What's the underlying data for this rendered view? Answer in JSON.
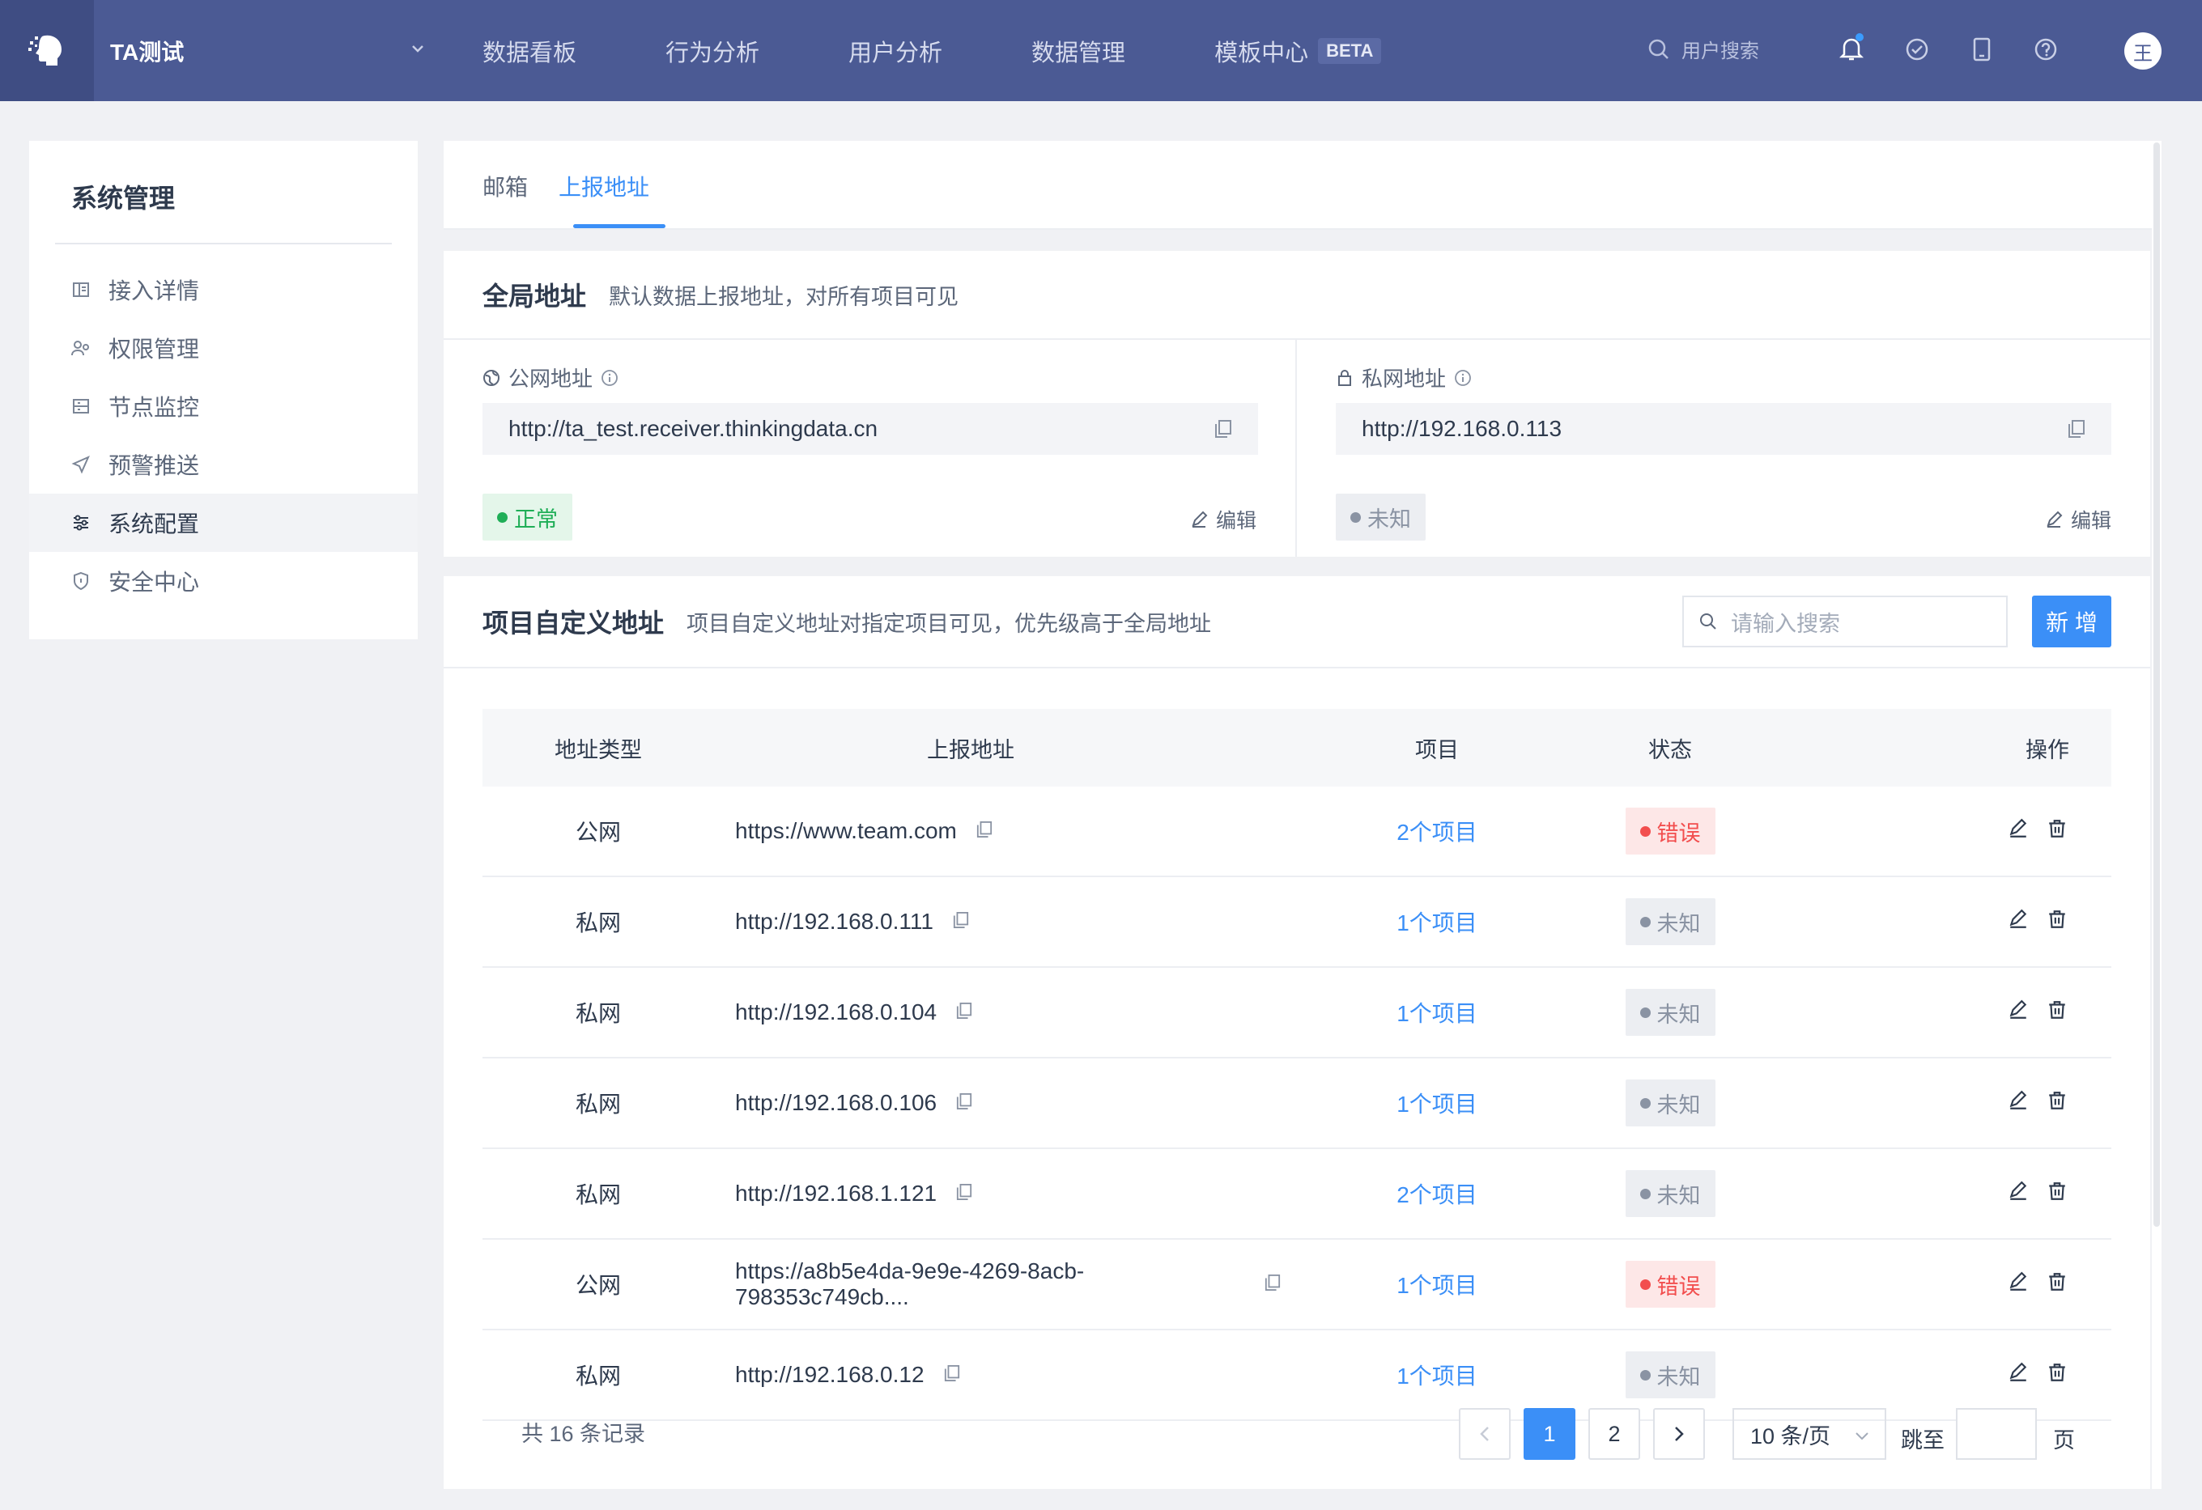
{
  "topbar": {
    "project_name": "TA测试",
    "nav": [
      "数据看板",
      "行为分析",
      "用户分析",
      "数据管理",
      "模板中心"
    ],
    "beta_label": "BETA",
    "search_placeholder": "用户搜索",
    "avatar_text": "王",
    "accent": "#4b5a94"
  },
  "sidebar": {
    "title": "系统管理",
    "items": [
      {
        "label": "接入详情",
        "icon": "book-icon"
      },
      {
        "label": "权限管理",
        "icon": "users-icon"
      },
      {
        "label": "节点监控",
        "icon": "monitor-icon"
      },
      {
        "label": "预警推送",
        "icon": "send-icon"
      },
      {
        "label": "系统配置",
        "icon": "sliders-icon",
        "active": true
      },
      {
        "label": "安全中心",
        "icon": "shield-icon"
      }
    ]
  },
  "tabs": [
    "邮箱",
    "上报地址"
  ],
  "active_tab": "上报地址",
  "global": {
    "title": "全局地址",
    "subtitle": "默认数据上报地址，对所有项目可见",
    "public": {
      "label": "公网地址",
      "url": "http://ta_test.receiver.thinkingdata.cn",
      "status": "正常",
      "edit": "编辑"
    },
    "private": {
      "label": "私网地址",
      "url": "http://192.168.0.113",
      "status": "未知",
      "edit": "编辑"
    }
  },
  "custom": {
    "title": "项目自定义地址",
    "subtitle": "项目自定义地址对指定项目可见，优先级高于全局地址",
    "search_placeholder": "请输入搜索",
    "add_label": "新 增",
    "columns": [
      "地址类型",
      "上报地址",
      "项目",
      "状态",
      "操作"
    ],
    "rows": [
      {
        "type": "公网",
        "url": "https://www.team.com",
        "project": "2个项目",
        "status": "错误",
        "state": "err"
      },
      {
        "type": "私网",
        "url": "http://192.168.0.111",
        "project": "1个项目",
        "status": "未知",
        "state": "unknown"
      },
      {
        "type": "私网",
        "url": "http://192.168.0.104",
        "project": "1个项目",
        "status": "未知",
        "state": "unknown"
      },
      {
        "type": "私网",
        "url": "http://192.168.0.106",
        "project": "1个项目",
        "status": "未知",
        "state": "unknown"
      },
      {
        "type": "私网",
        "url": "http://192.168.1.121",
        "project": "2个项目",
        "status": "未知",
        "state": "unknown"
      },
      {
        "type": "公网",
        "url": "https://a8b5e4da-9e9e-4269-8acb-798353c749cb....",
        "project": "1个项目",
        "status": "错误",
        "state": "err"
      },
      {
        "type": "私网",
        "url": "http://192.168.0.12",
        "project": "1个项目",
        "status": "未知",
        "state": "unknown"
      }
    ]
  },
  "pagination": {
    "total_text": "共 16 条记录",
    "pages": [
      "1",
      "2"
    ],
    "current": "1",
    "page_size": "10 条/页",
    "jump_label": "跳至",
    "page_suffix": "页"
  }
}
